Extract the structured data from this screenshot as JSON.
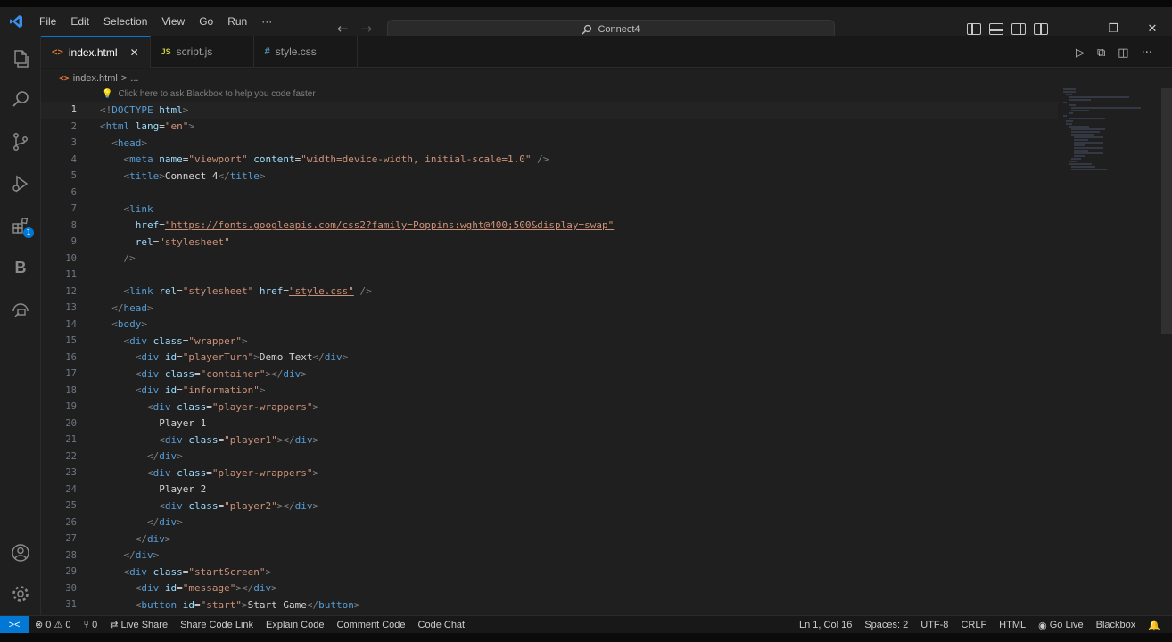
{
  "menu": [
    "File",
    "Edit",
    "Selection",
    "View",
    "Go",
    "Run",
    "···"
  ],
  "command_center": "Connect4",
  "tabs": [
    {
      "label": "index.html",
      "icon": "<>",
      "icon_color": "#e37933",
      "active": true
    },
    {
      "label": "script.js",
      "icon": "JS",
      "icon_color": "#cbcb41",
      "active": false
    },
    {
      "label": "style.css",
      "icon": "#",
      "icon_color": "#519aba",
      "active": false
    }
  ],
  "breadcrumb": {
    "file": "index.html",
    "sep": ">",
    "rest": "..."
  },
  "codelens": "Click here to ask Blackbox to help you code faster",
  "code_lines": [
    {
      "n": "1",
      "tokens": [
        [
          "punc",
          "<!"
        ],
        [
          "tag",
          "DOCTYPE"
        ],
        [
          "txt",
          " "
        ],
        [
          "attr",
          "html"
        ],
        [
          "punc",
          ">"
        ]
      ]
    },
    {
      "n": "2",
      "tokens": [
        [
          "punc",
          "<"
        ],
        [
          "tag",
          "html"
        ],
        [
          "txt",
          " "
        ],
        [
          "attr",
          "lang"
        ],
        [
          "txt",
          "="
        ],
        [
          "str",
          "\"en\""
        ],
        [
          "punc",
          ">"
        ]
      ]
    },
    {
      "n": "3",
      "tokens": [
        [
          "txt",
          "  "
        ],
        [
          "punc",
          "<"
        ],
        [
          "tag",
          "head"
        ],
        [
          "punc",
          ">"
        ]
      ]
    },
    {
      "n": "4",
      "tokens": [
        [
          "txt",
          "    "
        ],
        [
          "punc",
          "<"
        ],
        [
          "tag",
          "meta"
        ],
        [
          "txt",
          " "
        ],
        [
          "attr",
          "name"
        ],
        [
          "txt",
          "="
        ],
        [
          "str",
          "\"viewport\""
        ],
        [
          "txt",
          " "
        ],
        [
          "attr",
          "content"
        ],
        [
          "txt",
          "="
        ],
        [
          "str",
          "\"width=device-width, initial-scale=1.0\""
        ],
        [
          "txt",
          " "
        ],
        [
          "punc",
          "/>"
        ]
      ]
    },
    {
      "n": "5",
      "tokens": [
        [
          "txt",
          "    "
        ],
        [
          "punc",
          "<"
        ],
        [
          "tag",
          "title"
        ],
        [
          "punc",
          ">"
        ],
        [
          "txt",
          "Connect 4"
        ],
        [
          "punc",
          "</"
        ],
        [
          "tag",
          "title"
        ],
        [
          "punc",
          ">"
        ]
      ]
    },
    {
      "n": "6",
      "tokens": []
    },
    {
      "n": "7",
      "tokens": [
        [
          "txt",
          "    "
        ],
        [
          "punc",
          "<"
        ],
        [
          "tag",
          "link"
        ]
      ]
    },
    {
      "n": "8",
      "tokens": [
        [
          "txt",
          "      "
        ],
        [
          "attr",
          "href"
        ],
        [
          "txt",
          "="
        ],
        [
          "str",
          "\"https://fonts.googleapis.com/css2?family=Poppins:wght@400;500&display=swap\""
        ]
      ]
    },
    {
      "n": "9",
      "tokens": [
        [
          "txt",
          "      "
        ],
        [
          "attr",
          "rel"
        ],
        [
          "txt",
          "="
        ],
        [
          "str",
          "\"stylesheet\""
        ]
      ]
    },
    {
      "n": "10",
      "tokens": [
        [
          "txt",
          "    "
        ],
        [
          "punc",
          "/>"
        ]
      ]
    },
    {
      "n": "11",
      "tokens": []
    },
    {
      "n": "12",
      "tokens": [
        [
          "txt",
          "    "
        ],
        [
          "punc",
          "<"
        ],
        [
          "tag",
          "link"
        ],
        [
          "txt",
          " "
        ],
        [
          "attr",
          "rel"
        ],
        [
          "txt",
          "="
        ],
        [
          "str",
          "\"stylesheet\""
        ],
        [
          "txt",
          " "
        ],
        [
          "attr",
          "href"
        ],
        [
          "txt",
          "="
        ],
        [
          "str",
          "\"style.css\""
        ],
        [
          "txt",
          " "
        ],
        [
          "punc",
          "/>"
        ]
      ]
    },
    {
      "n": "13",
      "tokens": [
        [
          "txt",
          "  "
        ],
        [
          "punc",
          "</"
        ],
        [
          "tag",
          "head"
        ],
        [
          "punc",
          ">"
        ]
      ]
    },
    {
      "n": "14",
      "tokens": [
        [
          "txt",
          "  "
        ],
        [
          "punc",
          "<"
        ],
        [
          "tag",
          "body"
        ],
        [
          "punc",
          ">"
        ]
      ]
    },
    {
      "n": "15",
      "tokens": [
        [
          "txt",
          "    "
        ],
        [
          "punc",
          "<"
        ],
        [
          "tag",
          "div"
        ],
        [
          "txt",
          " "
        ],
        [
          "attr",
          "class"
        ],
        [
          "txt",
          "="
        ],
        [
          "str",
          "\"wrapper\""
        ],
        [
          "punc",
          ">"
        ]
      ]
    },
    {
      "n": "16",
      "tokens": [
        [
          "txt",
          "      "
        ],
        [
          "punc",
          "<"
        ],
        [
          "tag",
          "div"
        ],
        [
          "txt",
          " "
        ],
        [
          "attr",
          "id"
        ],
        [
          "txt",
          "="
        ],
        [
          "str",
          "\"playerTurn\""
        ],
        [
          "punc",
          ">"
        ],
        [
          "txt",
          "Demo Text"
        ],
        [
          "punc",
          "</"
        ],
        [
          "tag",
          "div"
        ],
        [
          "punc",
          ">"
        ]
      ]
    },
    {
      "n": "17",
      "tokens": [
        [
          "txt",
          "      "
        ],
        [
          "punc",
          "<"
        ],
        [
          "tag",
          "div"
        ],
        [
          "txt",
          " "
        ],
        [
          "attr",
          "class"
        ],
        [
          "txt",
          "="
        ],
        [
          "str",
          "\"container\""
        ],
        [
          "punc",
          "></"
        ],
        [
          "tag",
          "div"
        ],
        [
          "punc",
          ">"
        ]
      ]
    },
    {
      "n": "18",
      "tokens": [
        [
          "txt",
          "      "
        ],
        [
          "punc",
          "<"
        ],
        [
          "tag",
          "div"
        ],
        [
          "txt",
          " "
        ],
        [
          "attr",
          "id"
        ],
        [
          "txt",
          "="
        ],
        [
          "str",
          "\"information\""
        ],
        [
          "punc",
          ">"
        ]
      ]
    },
    {
      "n": "19",
      "tokens": [
        [
          "txt",
          "        "
        ],
        [
          "punc",
          "<"
        ],
        [
          "tag",
          "div"
        ],
        [
          "txt",
          " "
        ],
        [
          "attr",
          "class"
        ],
        [
          "txt",
          "="
        ],
        [
          "str",
          "\"player-wrappers\""
        ],
        [
          "punc",
          ">"
        ]
      ]
    },
    {
      "n": "20",
      "tokens": [
        [
          "txt",
          "          Player 1"
        ]
      ]
    },
    {
      "n": "21",
      "tokens": [
        [
          "txt",
          "          "
        ],
        [
          "punc",
          "<"
        ],
        [
          "tag",
          "div"
        ],
        [
          "txt",
          " "
        ],
        [
          "attr",
          "class"
        ],
        [
          "txt",
          "="
        ],
        [
          "str",
          "\"player1\""
        ],
        [
          "punc",
          "></"
        ],
        [
          "tag",
          "div"
        ],
        [
          "punc",
          ">"
        ]
      ]
    },
    {
      "n": "22",
      "tokens": [
        [
          "txt",
          "        "
        ],
        [
          "punc",
          "</"
        ],
        [
          "tag",
          "div"
        ],
        [
          "punc",
          ">"
        ]
      ]
    },
    {
      "n": "23",
      "tokens": [
        [
          "txt",
          "        "
        ],
        [
          "punc",
          "<"
        ],
        [
          "tag",
          "div"
        ],
        [
          "txt",
          " "
        ],
        [
          "attr",
          "class"
        ],
        [
          "txt",
          "="
        ],
        [
          "str",
          "\"player-wrappers\""
        ],
        [
          "punc",
          ">"
        ]
      ]
    },
    {
      "n": "24",
      "tokens": [
        [
          "txt",
          "          Player 2"
        ]
      ]
    },
    {
      "n": "25",
      "tokens": [
        [
          "txt",
          "          "
        ],
        [
          "punc",
          "<"
        ],
        [
          "tag",
          "div"
        ],
        [
          "txt",
          " "
        ],
        [
          "attr",
          "class"
        ],
        [
          "txt",
          "="
        ],
        [
          "str",
          "\"player2\""
        ],
        [
          "punc",
          "></"
        ],
        [
          "tag",
          "div"
        ],
        [
          "punc",
          ">"
        ]
      ]
    },
    {
      "n": "26",
      "tokens": [
        [
          "txt",
          "        "
        ],
        [
          "punc",
          "</"
        ],
        [
          "tag",
          "div"
        ],
        [
          "punc",
          ">"
        ]
      ]
    },
    {
      "n": "27",
      "tokens": [
        [
          "txt",
          "      "
        ],
        [
          "punc",
          "</"
        ],
        [
          "tag",
          "div"
        ],
        [
          "punc",
          ">"
        ]
      ]
    },
    {
      "n": "28",
      "tokens": [
        [
          "txt",
          "    "
        ],
        [
          "punc",
          "</"
        ],
        [
          "tag",
          "div"
        ],
        [
          "punc",
          ">"
        ]
      ]
    },
    {
      "n": "29",
      "tokens": [
        [
          "txt",
          "    "
        ],
        [
          "punc",
          "<"
        ],
        [
          "tag",
          "div"
        ],
        [
          "txt",
          " "
        ],
        [
          "attr",
          "class"
        ],
        [
          "txt",
          "="
        ],
        [
          "str",
          "\"startScreen\""
        ],
        [
          "punc",
          ">"
        ]
      ]
    },
    {
      "n": "30",
      "tokens": [
        [
          "txt",
          "      "
        ],
        [
          "punc",
          "<"
        ],
        [
          "tag",
          "div"
        ],
        [
          "txt",
          " "
        ],
        [
          "attr",
          "id"
        ],
        [
          "txt",
          "="
        ],
        [
          "str",
          "\"message\""
        ],
        [
          "punc",
          "></"
        ],
        [
          "tag",
          "div"
        ],
        [
          "punc",
          ">"
        ]
      ]
    },
    {
      "n": "31",
      "tokens": [
        [
          "txt",
          "      "
        ],
        [
          "punc",
          "<"
        ],
        [
          "tag",
          "button"
        ],
        [
          "txt",
          " "
        ],
        [
          "attr",
          "id"
        ],
        [
          "txt",
          "="
        ],
        [
          "str",
          "\"start\""
        ],
        [
          "punc",
          ">"
        ],
        [
          "txt",
          "Start Game"
        ],
        [
          "punc",
          "</"
        ],
        [
          "tag",
          "button"
        ],
        [
          "punc",
          ">"
        ]
      ]
    }
  ],
  "status": {
    "remote": "><",
    "problems": "⊗ 0 ⚠ 0",
    "ports": "⑂ 0",
    "live_share": "Live Share",
    "share_code_link": "Share Code Link",
    "explain_code": "Explain Code",
    "comment_code": "Comment Code",
    "code_chat": "Code Chat",
    "position": "Ln 1, Col 16",
    "spaces": "Spaces: 2",
    "encoding": "UTF-8",
    "eol": "CRLF",
    "language": "HTML",
    "go_live": "Go Live",
    "blackbox": "Blackbox"
  },
  "icons": [
    "vscode-logo-icon",
    "explorer-icon",
    "search-icon",
    "source-control-icon",
    "run-debug-icon",
    "extensions-icon",
    "blackbox-icon",
    "remote-explorer-icon",
    "account-icon",
    "settings-gear-icon"
  ]
}
